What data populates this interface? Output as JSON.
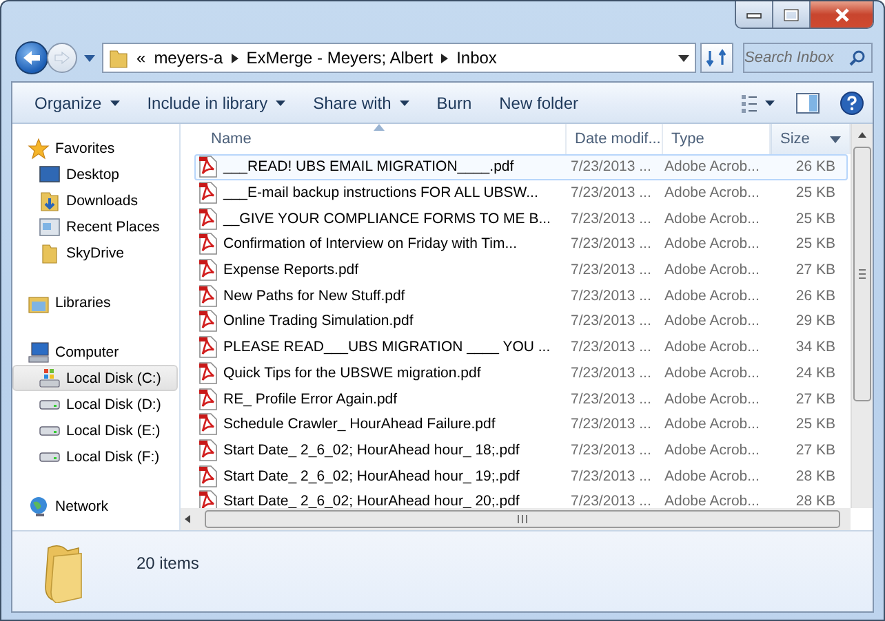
{
  "address": {
    "overflow": "«",
    "crumbs": [
      "meyers-a",
      "ExMerge - Meyers; Albert",
      "Inbox"
    ]
  },
  "search": {
    "placeholder": "Search Inbox"
  },
  "toolbar": [
    {
      "label": "Organize",
      "dropdown": true
    },
    {
      "label": "Include in library",
      "dropdown": true
    },
    {
      "label": "Share with",
      "dropdown": true
    },
    {
      "label": "Burn",
      "dropdown": false
    },
    {
      "label": "New folder",
      "dropdown": false
    }
  ],
  "sidebar": {
    "groups": [
      {
        "label": "Favorites",
        "kind": "star",
        "selected": false,
        "children": [
          {
            "label": "Desktop",
            "kind": "desktop",
            "selected": false
          },
          {
            "label": "Downloads",
            "kind": "downloads",
            "selected": false
          },
          {
            "label": "Recent Places",
            "kind": "recent",
            "selected": false
          },
          {
            "label": "SkyDrive",
            "kind": "folder",
            "selected": false
          }
        ]
      },
      {
        "label": "Libraries",
        "kind": "library",
        "selected": false
      },
      {
        "label": "Computer",
        "kind": "computer",
        "selected": false,
        "children": [
          {
            "label": "Local Disk (C:)",
            "kind": "system-disk",
            "selected": true
          },
          {
            "label": "Local Disk (D:)",
            "kind": "disk",
            "selected": false
          },
          {
            "label": "Local Disk (E:)",
            "kind": "disk",
            "selected": false
          },
          {
            "label": "Local Disk (F:)",
            "kind": "disk",
            "selected": false
          }
        ]
      },
      {
        "label": "Network",
        "kind": "network",
        "selected": false
      }
    ]
  },
  "table": {
    "columns": [
      {
        "label": "Name",
        "sorted": true,
        "highlighted": false
      },
      {
        "label": "Date modif...",
        "sorted": false,
        "highlighted": false
      },
      {
        "label": "Type",
        "sorted": false,
        "highlighted": false
      },
      {
        "label": "Size",
        "sorted": false,
        "highlighted": true
      }
    ],
    "rows": [
      {
        "name": "___READ! UBS EMAIL MIGRATION____.pdf",
        "date": "7/23/2013 ...",
        "type": "Adobe Acrob...",
        "size": "26 KB",
        "selected": true
      },
      {
        "name": "___E-mail backup instructions FOR ALL UBSW...",
        "date": "7/23/2013 ...",
        "type": "Adobe Acrob...",
        "size": "25 KB",
        "selected": false
      },
      {
        "name": "__GIVE YOUR COMPLIANCE FORMS TO ME B...",
        "date": "7/23/2013 ...",
        "type": "Adobe Acrob...",
        "size": "25 KB",
        "selected": false
      },
      {
        "name": "Confirmation of Interview on Friday with Tim...",
        "date": "7/23/2013 ...",
        "type": "Adobe Acrob...",
        "size": "25 KB",
        "selected": false
      },
      {
        "name": "Expense Reports.pdf",
        "date": "7/23/2013 ...",
        "type": "Adobe Acrob...",
        "size": "27 KB",
        "selected": false
      },
      {
        "name": "New Paths for New Stuff.pdf",
        "date": "7/23/2013 ...",
        "type": "Adobe Acrob...",
        "size": "26 KB",
        "selected": false
      },
      {
        "name": "Online Trading Simulation.pdf",
        "date": "7/23/2013 ...",
        "type": "Adobe Acrob...",
        "size": "29 KB",
        "selected": false
      },
      {
        "name": "PLEASE READ___UBS MIGRATION ____ YOU ...",
        "date": "7/23/2013 ...",
        "type": "Adobe Acrob...",
        "size": "34 KB",
        "selected": false
      },
      {
        "name": "Quick Tips for the UBSWE migration.pdf",
        "date": "7/23/2013 ...",
        "type": "Adobe Acrob...",
        "size": "24 KB",
        "selected": false
      },
      {
        "name": "RE_ Profile Error Again.pdf",
        "date": "7/23/2013 ...",
        "type": "Adobe Acrob...",
        "size": "27 KB",
        "selected": false
      },
      {
        "name": "Schedule Crawler_ HourAhead Failure.pdf",
        "date": "7/23/2013 ...",
        "type": "Adobe Acrob...",
        "size": "25 KB",
        "selected": false
      },
      {
        "name": "Start Date_ 2_6_02; HourAhead hour_ 18;.pdf",
        "date": "7/23/2013 ...",
        "type": "Adobe Acrob...",
        "size": "27 KB",
        "selected": false
      },
      {
        "name": "Start Date_ 2_6_02; HourAhead hour_ 19;.pdf",
        "date": "7/23/2013 ...",
        "type": "Adobe Acrob...",
        "size": "28 KB",
        "selected": false
      },
      {
        "name": "Start Date_ 2_6_02; HourAhead hour_ 20;.pdf",
        "date": "7/23/2013 ...",
        "type": "Adobe Acrob...",
        "size": "28 KB",
        "selected": false
      }
    ]
  },
  "details": {
    "count": "20 items"
  }
}
